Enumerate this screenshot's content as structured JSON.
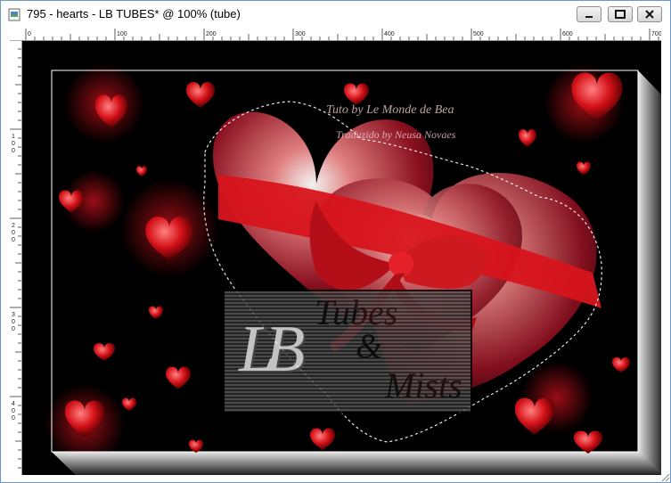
{
  "window": {
    "title": "795 - hearts - LB TUBES* @ 100% (tube)"
  },
  "ruler": {
    "top_labels": [
      "0",
      "100",
      "200",
      "300",
      "400",
      "500",
      "600",
      "700"
    ],
    "left_labels": [
      "1\n0\n0",
      "2\n0\n0",
      "3\n0\n0",
      "4\n0\n0"
    ]
  },
  "canvas": {
    "watermark_line1": "Tuto by Le Monde de Bea",
    "watermark_line2": "Traduzido by Neusa Novaes",
    "logo_lb": "LB",
    "logo_tubes": "Tubes",
    "logo_amp": "&",
    "logo_mists": "Mists"
  },
  "colors": {
    "title_bar_bg": "#ffffff",
    "canvas_bg": "#000000",
    "heart_red": "#d4141c",
    "close_button": "#c74a35"
  },
  "icons": {
    "app_icon": "image-document-icon",
    "minimize": "minimize-icon",
    "maximize": "maximize-icon",
    "close": "close-icon"
  }
}
